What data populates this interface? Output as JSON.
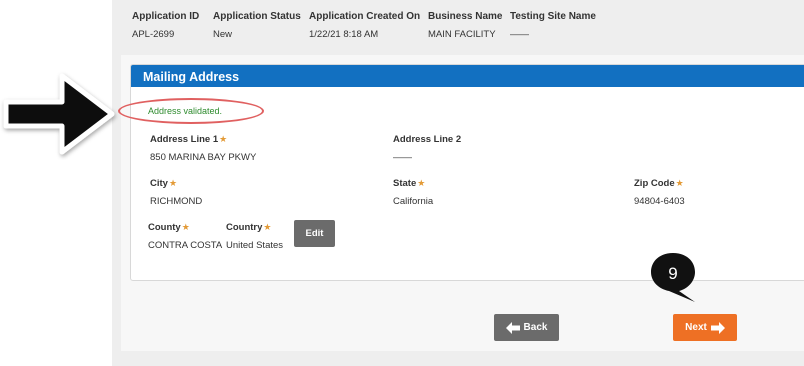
{
  "header": {
    "columns": [
      {
        "label": "Application ID",
        "value": "APL-2699"
      },
      {
        "label": "Application Status",
        "value": "New"
      },
      {
        "label": "Application Created On",
        "value": "1/22/21 8:18 AM"
      },
      {
        "label": "Business Name",
        "value": "MAIN FACILITY"
      },
      {
        "label": "Testing Site Name",
        "value": "——"
      }
    ]
  },
  "mailing": {
    "title": "Mailing Address",
    "validated_msg": "Address validated.",
    "required_mark": "★",
    "fields": {
      "address1": {
        "label": "Address Line 1",
        "value": "850 MARINA BAY PKWY"
      },
      "address2": {
        "label": "Address Line 2",
        "value": "——"
      },
      "city": {
        "label": "City",
        "value": "RICHMOND"
      },
      "state": {
        "label": "State",
        "value": "California"
      },
      "zip": {
        "label": "Zip Code",
        "value": "94804-6403"
      },
      "county": {
        "label": "County",
        "value": "CONTRA COSTA"
      },
      "country": {
        "label": "Country",
        "value": "United States"
      }
    },
    "edit_label": "Edit"
  },
  "nav": {
    "back_label": "Back",
    "next_label": "Next"
  },
  "annotation": {
    "step_number": "9"
  }
}
